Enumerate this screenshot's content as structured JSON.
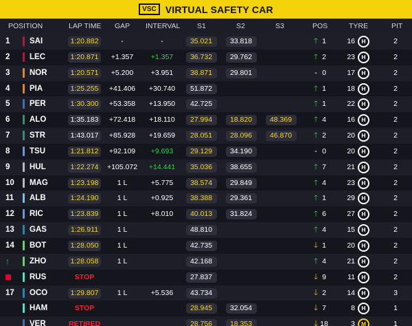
{
  "banner": {
    "badge": "VSC",
    "title": "VIRTUAL SAFETY CAR",
    "color": "#f5d30a"
  },
  "headers": {
    "position": "POSITION",
    "lap_time": "LAP TIME",
    "gap": "GAP",
    "interval": "INTERVAL",
    "s1": "S1",
    "s2": "S2",
    "s3": "S3",
    "pos": "POS",
    "tyre": "TYRE",
    "pit": "PIT"
  },
  "rows": [
    {
      "pos": "1",
      "driver": "SAI",
      "team_color": "#e8002d",
      "lap": "1:20.882",
      "lap_style": "yellow",
      "gap": "-",
      "interval": "-",
      "interval_style": "",
      "s1": "35.021",
      "s1_style": "yellow",
      "s2": "33.818",
      "s2_style": "",
      "s3": "",
      "s3_style": "",
      "arrow": "up",
      "change": "1",
      "laps": "16",
      "tyre": "H",
      "tyre_type": "hard",
      "pit": "2"
    },
    {
      "pos": "2",
      "driver": "LEC",
      "team_color": "#e8002d",
      "lap": "1:20.871",
      "lap_style": "yellow",
      "gap": "+1.357",
      "interval": "+1.357",
      "interval_style": "green",
      "s1": "36.732",
      "s1_style": "yellow",
      "s2": "29.762",
      "s2_style": "",
      "s3": "",
      "s3_style": "",
      "arrow": "up",
      "change": "2",
      "laps": "23",
      "tyre": "H",
      "tyre_type": "hard",
      "pit": "2"
    },
    {
      "pos": "3",
      "driver": "NOR",
      "team_color": "#ff8000",
      "lap": "1:20.571",
      "lap_style": "yellow",
      "gap": "+5.200",
      "interval": "+3.951",
      "interval_style": "",
      "s1": "38.871",
      "s1_style": "yellow",
      "s2": "29.801",
      "s2_style": "",
      "s3": "",
      "s3_style": "",
      "arrow": "none",
      "change": "0",
      "laps": "17",
      "tyre": "H",
      "tyre_type": "hard",
      "pit": "2"
    },
    {
      "pos": "4",
      "driver": "PIA",
      "team_color": "#ff8000",
      "lap": "1:25.255",
      "lap_style": "yellow",
      "gap": "+41.406",
      "interval": "+30.740",
      "interval_style": "",
      "s1": "51.872",
      "s1_style": "",
      "s2": "",
      "s2_style": "",
      "s3": "",
      "s3_style": "",
      "arrow": "up",
      "change": "1",
      "laps": "18",
      "tyre": "H",
      "tyre_type": "hard",
      "pit": "2"
    },
    {
      "pos": "5",
      "driver": "PER",
      "team_color": "#3671c6",
      "lap": "1:30.300",
      "lap_style": "yellow",
      "gap": "+53.358",
      "interval": "+13.950",
      "interval_style": "",
      "s1": "42.725",
      "s1_style": "",
      "s2": "",
      "s2_style": "",
      "s3": "",
      "s3_style": "",
      "arrow": "up",
      "change": "1",
      "laps": "22",
      "tyre": "H",
      "tyre_type": "hard",
      "pit": "2"
    },
    {
      "pos": "6",
      "driver": "ALO",
      "team_color": "#229971",
      "lap": "1:35.183",
      "lap_style": "",
      "gap": "+72.418",
      "interval": "+18.110",
      "interval_style": "",
      "s1": "27.994",
      "s1_style": "yellow",
      "s2": "18.820",
      "s2_style": "yellow",
      "s3": "48.369",
      "s3_style": "yellow",
      "arrow": "up",
      "change": "4",
      "laps": "16",
      "tyre": "H",
      "tyre_type": "hard",
      "pit": "2"
    },
    {
      "pos": "7",
      "driver": "STR",
      "team_color": "#229971",
      "lap": "1:43.017",
      "lap_style": "",
      "gap": "+85.928",
      "interval": "+19.659",
      "interval_style": "",
      "s1": "28.051",
      "s1_style": "yellow",
      "s2": "28.096",
      "s2_style": "yellow",
      "s3": "46.870",
      "s3_style": "yellow",
      "arrow": "up",
      "change": "2",
      "laps": "20",
      "tyre": "H",
      "tyre_type": "hard",
      "pit": "2"
    },
    {
      "pos": "8",
      "driver": "TSU",
      "team_color": "#6692ff",
      "lap": "1:21.812",
      "lap_style": "yellow",
      "gap": "+92.109",
      "interval": "+9.693",
      "interval_style": "green",
      "s1": "29.129",
      "s1_style": "yellow",
      "s2": "34.190",
      "s2_style": "",
      "s3": "",
      "s3_style": "",
      "arrow": "none",
      "change": "0",
      "laps": "20",
      "tyre": "H",
      "tyre_type": "hard",
      "pit": "2"
    },
    {
      "pos": "9",
      "driver": "HUL",
      "team_color": "#b6babd",
      "lap": "1:22.274",
      "lap_style": "yellow",
      "gap": "+105.072",
      "interval": "+14.441",
      "interval_style": "green",
      "s1": "35.036",
      "s1_style": "yellow",
      "s2": "38.655",
      "s2_style": "",
      "s3": "",
      "s3_style": "",
      "arrow": "up",
      "change": "7",
      "laps": "21",
      "tyre": "H",
      "tyre_type": "hard",
      "pit": "2"
    },
    {
      "pos": "10",
      "driver": "MAG",
      "team_color": "#b6babd",
      "lap": "1:23.198",
      "lap_style": "yellow",
      "gap": "1 L",
      "interval": "+5.775",
      "interval_style": "",
      "s1": "38.574",
      "s1_style": "yellow",
      "s2": "29.849",
      "s2_style": "",
      "s3": "",
      "s3_style": "",
      "arrow": "up",
      "change": "4",
      "laps": "23",
      "tyre": "H",
      "tyre_type": "hard",
      "pit": "2"
    },
    {
      "pos": "11",
      "driver": "ALB",
      "team_color": "#64c4ff",
      "lap": "1:24.190",
      "lap_style": "yellow",
      "gap": "1 L",
      "interval": "+0.925",
      "interval_style": "",
      "s1": "38.388",
      "s1_style": "yellow",
      "s2": "29.361",
      "s2_style": "",
      "s3": "",
      "s3_style": "",
      "arrow": "up",
      "change": "1",
      "laps": "29",
      "tyre": "H",
      "tyre_type": "hard",
      "pit": "2"
    },
    {
      "pos": "12",
      "driver": "RIC",
      "team_color": "#6692ff",
      "lap": "1:23.839",
      "lap_style": "yellow",
      "gap": "1 L",
      "interval": "+8.010",
      "interval_style": "",
      "s1": "40.013",
      "s1_style": "yellow",
      "s2": "31.824",
      "s2_style": "",
      "s3": "",
      "s3_style": "",
      "arrow": "up",
      "change": "6",
      "laps": "27",
      "tyre": "H",
      "tyre_type": "hard",
      "pit": "2"
    },
    {
      "pos": "13",
      "driver": "GAS",
      "team_color": "#0093cc",
      "lap": "1:26.911",
      "lap_style": "yellow",
      "gap": "1 L",
      "interval": "",
      "interval_style": "",
      "s1": "48.810",
      "s1_style": "",
      "s2": "",
      "s2_style": "",
      "s3": "",
      "s3_style": "",
      "arrow": "up",
      "change": "4",
      "laps": "15",
      "tyre": "H",
      "tyre_type": "hard",
      "pit": "2"
    },
    {
      "pos": "14",
      "driver": "BOT",
      "team_color": "#52e252",
      "lap": "1:28.050",
      "lap_style": "yellow",
      "gap": "1 L",
      "interval": "",
      "interval_style": "",
      "s1": "42.735",
      "s1_style": "",
      "s2": "",
      "s2_style": "",
      "s3": "",
      "s3_style": "",
      "arrow": "down",
      "change": "1",
      "laps": "20",
      "tyre": "H",
      "tyre_type": "hard",
      "pit": "2"
    },
    {
      "pos": "↑",
      "driver": "ZHO",
      "team_color": "#52e252",
      "lap": "1:28.058",
      "lap_style": "yellow",
      "gap": "1 L",
      "interval": "",
      "interval_style": "",
      "s1": "42.168",
      "s1_style": "",
      "s2": "",
      "s2_style": "",
      "s3": "",
      "s3_style": "",
      "arrow": "up",
      "change": "4",
      "laps": "21",
      "tyre": "H",
      "tyre_type": "hard",
      "pit": "2"
    },
    {
      "pos": "■",
      "driver": "RUS",
      "team_color": "#27f4d2",
      "lap": "STOP",
      "lap_style": "red",
      "gap": "",
      "interval": "",
      "interval_style": "",
      "s1": "27.837",
      "s1_style": "",
      "s2": "",
      "s2_style": "",
      "s3": "",
      "s3_style": "",
      "arrow": "down",
      "change": "9",
      "laps": "11",
      "tyre": "H",
      "tyre_type": "hard",
      "pit": "2"
    },
    {
      "pos": "17",
      "driver": "OCO",
      "team_color": "#0093cc",
      "lap": "1:29.807",
      "lap_style": "yellow",
      "gap": "1 L",
      "interval": "+5.536",
      "interval_style": "",
      "s1": "43.734",
      "s1_style": "",
      "s2": "",
      "s2_style": "",
      "s3": "",
      "s3_style": "",
      "arrow": "down",
      "change": "2",
      "laps": "14",
      "tyre": "H",
      "tyre_type": "hard",
      "pit": "3"
    },
    {
      "pos": "",
      "driver": "HAM",
      "team_color": "#27f4d2",
      "lap": "STOP",
      "lap_style": "red",
      "gap": "",
      "interval": "",
      "interval_style": "",
      "s1": "28.945",
      "s1_style": "yellow",
      "s2": "32.054",
      "s2_style": "",
      "s3": "",
      "s3_style": "",
      "arrow": "down",
      "change": "7",
      "laps": "8",
      "tyre": "H",
      "tyre_type": "hard",
      "pit": "1"
    },
    {
      "pos": "",
      "driver": "VER",
      "team_color": "#3671c6",
      "lap": "RETIRED",
      "lap_style": "red",
      "gap": "",
      "interval": "",
      "interval_style": "",
      "s1": "28.756",
      "s1_style": "yellow",
      "s2": "18.353",
      "s2_style": "yellow",
      "s3": "",
      "s3_style": "",
      "arrow": "down",
      "change": "18",
      "laps": "3",
      "tyre": "M",
      "tyre_type": "medium",
      "pit": "1"
    }
  ]
}
